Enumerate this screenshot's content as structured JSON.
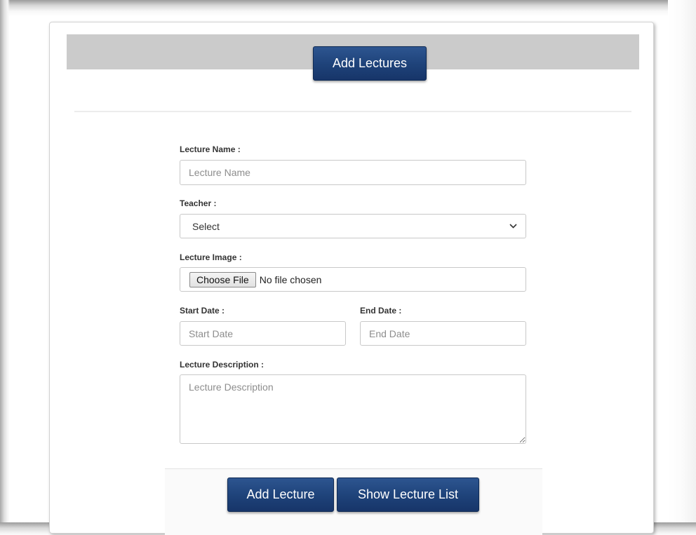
{
  "header": {
    "title_button": "Add Lectures"
  },
  "form": {
    "lecture_name": {
      "label": "Lecture Name :",
      "placeholder": "Lecture Name"
    },
    "teacher": {
      "label": "Teacher :",
      "selected": "Select"
    },
    "lecture_image": {
      "label": "Lecture Image :",
      "button": "Choose File",
      "status": "No file chosen"
    },
    "start_date": {
      "label": "Start Date :",
      "placeholder": "Start Date"
    },
    "end_date": {
      "label": "End Date :",
      "placeholder": "End Date"
    },
    "lecture_description": {
      "label": "Lecture Description :",
      "placeholder": "Lecture Description"
    }
  },
  "footer": {
    "add_button": "Add Lecture",
    "list_button": "Show Lecture List"
  },
  "colors": {
    "button_blue": "#1e4279",
    "header_bar": "#cbcbcb"
  },
  "icons": {
    "select_arrow": "chevron-down-icon"
  }
}
